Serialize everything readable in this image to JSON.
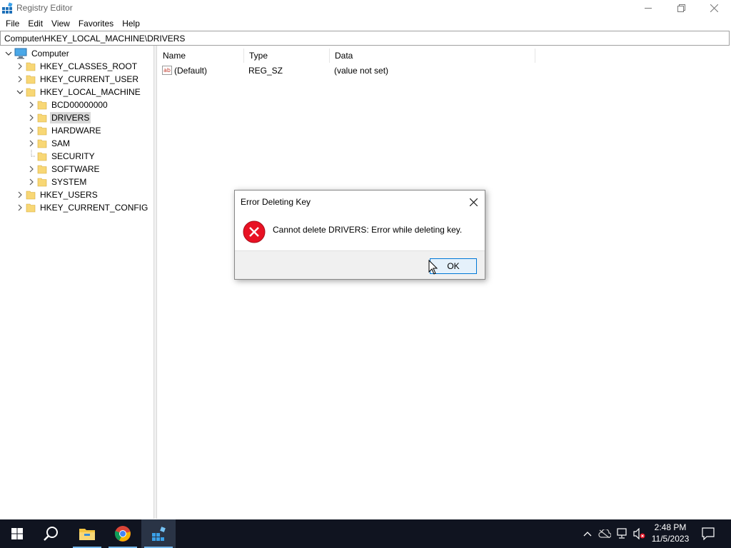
{
  "window": {
    "title": "Registry Editor"
  },
  "menu": [
    "File",
    "Edit",
    "View",
    "Favorites",
    "Help"
  ],
  "address": "Computer\\HKEY_LOCAL_MACHINE\\DRIVERS",
  "tree": {
    "root": "Computer",
    "hives": [
      "HKEY_CLASSES_ROOT",
      "HKEY_CURRENT_USER",
      "HKEY_LOCAL_MACHINE",
      "HKEY_USERS",
      "HKEY_CURRENT_CONFIG"
    ],
    "hklm_children": [
      "BCD00000000",
      "DRIVERS",
      "HARDWARE",
      "SAM",
      "SECURITY",
      "SOFTWARE",
      "SYSTEM"
    ],
    "selected": "DRIVERS"
  },
  "list": {
    "columns": [
      "Name",
      "Type",
      "Data"
    ],
    "rows": [
      {
        "name": "(Default)",
        "type": "REG_SZ",
        "data": "(value not set)",
        "icon": "string-value-icon"
      }
    ]
  },
  "dialog": {
    "title": "Error Deleting Key",
    "message": "Cannot delete DRIVERS:  Error while deleting key.",
    "ok_label": "OK",
    "icon": "error-icon"
  },
  "taskbar": {
    "apps": [
      "start-icon",
      "search-icon",
      "file-explorer-icon",
      "chrome-icon",
      "registry-editor-icon"
    ],
    "time": "2:48 PM",
    "date": "11/5/2023"
  },
  "colors": {
    "selection": "#d9d9d9",
    "accent": "#0078d7",
    "error": "#e81123",
    "taskbar": "#101420",
    "folder": "#f8d775"
  }
}
